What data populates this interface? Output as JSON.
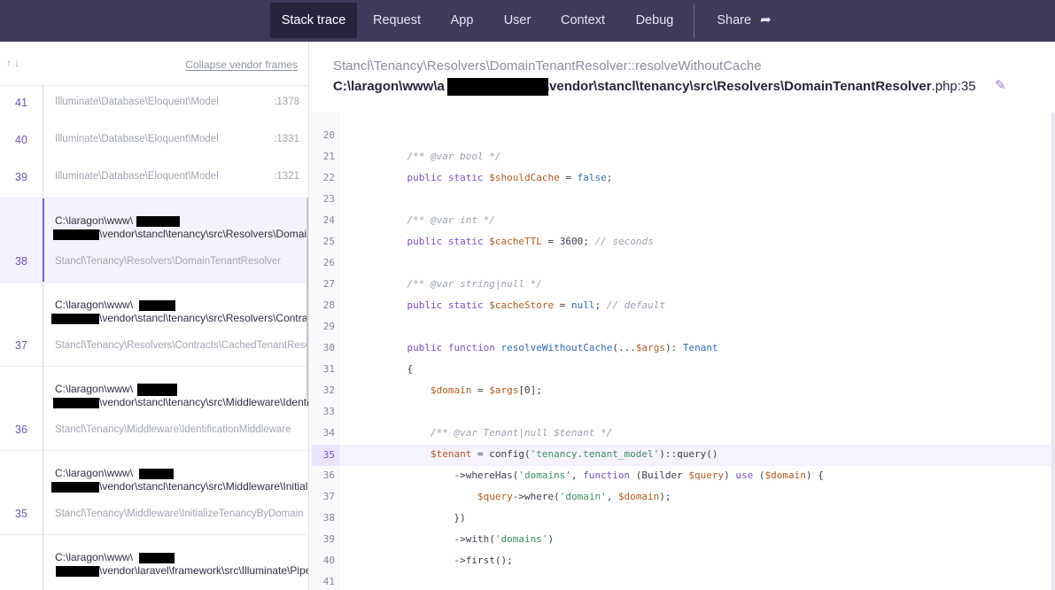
{
  "nav": {
    "tabs": [
      {
        "label": "Stack trace",
        "active": true
      },
      {
        "label": "Request"
      },
      {
        "label": "App"
      },
      {
        "label": "User"
      },
      {
        "label": "Context"
      },
      {
        "label": "Debug"
      }
    ],
    "share_label": "Share",
    "share_icon": "share-arrow-icon"
  },
  "sidebar": {
    "arrows": "↑↓",
    "collapse_label": "Collapse vendor frames",
    "vendor_frames": [
      {
        "number": "41",
        "class": "Illuminate\\Database\\Eloquent\\Model",
        "line": ":1378"
      },
      {
        "number": "40",
        "class": "Illuminate\\Database\\Eloquent\\Model",
        "line": ":1331"
      },
      {
        "number": "39",
        "class": "Illuminate\\Database\\Eloquent\\Model",
        "line": ":1321"
      }
    ],
    "frames": [
      {
        "number": "38",
        "path1": "C:\\laragon\\www\\",
        "path2": "\\vendor\\stancl\\tenancy\\src\\Resolvers\\DomainTenantResolver.php",
        "class": "Stancl\\Tenancy\\Resolvers\\DomainTenantResolver",
        "selected": true
      },
      {
        "number": "37",
        "path1": "C:\\laragon\\www\\",
        "path2": "\\vendor\\stancl\\tenancy\\src\\Resolvers\\Contracts\\CachedTenantResolver.php",
        "class": "Stancl\\Tenancy\\Resolvers\\Contracts\\CachedTenantResolver"
      },
      {
        "number": "36",
        "path1": "C:\\laragon\\www\\",
        "path2": "\\vendor\\stancl\\tenancy\\src\\Middleware\\IdentificationMiddleware.php",
        "class": "Stancl\\Tenancy\\Middleware\\IdentificationMiddleware"
      },
      {
        "number": "35",
        "path1": "C:\\laragon\\www\\",
        "path2": "\\vendor\\stancl\\tenancy\\src\\Middleware\\InitializeTenancyByDomain.php",
        "class": "Stancl\\Tenancy\\Middleware\\InitializeTenancyByDomain"
      },
      {
        "number": "",
        "path1": "C:\\laragon\\www\\",
        "path2": "\\vendor\\laravel\\framework\\src\\Illuminate\\Pipeline\\Pipeline.php",
        "class": ""
      }
    ]
  },
  "main": {
    "class_method": "Stancl\\Tenancy\\Resolvers\\DomainTenantResolver::resolveWithoutCache",
    "path_prefix": "C:\\laragon\\www\\a",
    "path_suffix": "\\vendor\\stancl\\tenancy\\src\\Resolvers\\DomainTenantResolver",
    "path_ext": ".php:35",
    "edit_icon": "pencil-icon",
    "highlight_line": 35,
    "code": [
      {
        "n": "20",
        "t": ""
      },
      {
        "n": "21",
        "t": "    /** @var bool */"
      },
      {
        "n": "22",
        "t": "    public static $shouldCache = false;"
      },
      {
        "n": "23",
        "t": ""
      },
      {
        "n": "24",
        "t": "    /** @var int */"
      },
      {
        "n": "25",
        "t": "    public static $cacheTTL = 3600; // seconds"
      },
      {
        "n": "26",
        "t": ""
      },
      {
        "n": "27",
        "t": "    /** @var string|null */"
      },
      {
        "n": "28",
        "t": "    public static $cacheStore = null; // default"
      },
      {
        "n": "29",
        "t": ""
      },
      {
        "n": "30",
        "t": "    public function resolveWithoutCache(...$args): Tenant"
      },
      {
        "n": "31",
        "t": "    {"
      },
      {
        "n": "32",
        "t": "        $domain = $args[0];"
      },
      {
        "n": "33",
        "t": ""
      },
      {
        "n": "34",
        "t": "        /** @var Tenant|null $tenant */"
      },
      {
        "n": "35",
        "t": "        $tenant = config('tenancy.tenant_model')::query()"
      },
      {
        "n": "36",
        "t": "            ->whereHas('domains', function (Builder $query) use ($domain) {"
      },
      {
        "n": "37",
        "t": "                $query->where('domain', $domain);"
      },
      {
        "n": "38",
        "t": "            })"
      },
      {
        "n": "39",
        "t": "            ->with('domains')"
      },
      {
        "n": "40",
        "t": "            ->first();"
      },
      {
        "n": "41",
        "t": ""
      }
    ]
  }
}
